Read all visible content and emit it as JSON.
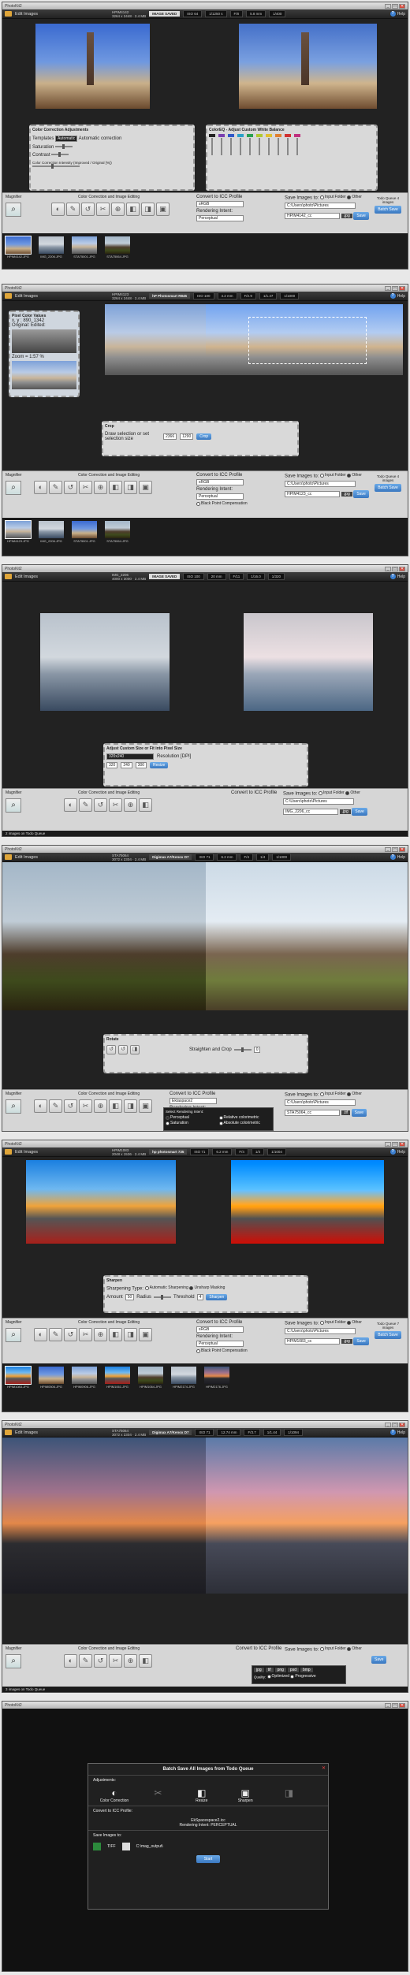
{
  "app": {
    "title": "PhotoKit2",
    "toolbar_button": "Edit Images",
    "help": "Help",
    "help_glyph": "?"
  },
  "window_controls": {
    "minimize": "_",
    "maximize": "□",
    "close": "✕"
  },
  "icons": {
    "folder": "folder-icon",
    "magnifier": "⌕",
    "tools": [
      "◐",
      "✎",
      "↺",
      "✂",
      "⊕",
      "◧",
      "◨",
      "▣"
    ]
  },
  "windows": [
    {
      "meta": [
        "HPIM4142",
        "3264 x 2448",
        "2.4 MB"
      ],
      "badge": "IMAGE SAVED",
      "stats": [
        "ISO 64",
        "1/1250 s",
        "F/8",
        "5.8 mm",
        "1/400"
      ],
      "panel_left": {
        "title": "Color Correction Adjustments",
        "templates_label": "Templates",
        "templates_value": "Automatic",
        "automatic_label": "Automatic correction",
        "saturation": "Saturation",
        "contrast": "Contrast",
        "intensity": "Color Correction Intensity (Improved / Original [%])"
      },
      "panel_right": {
        "title": "ColorEQ - Adjust Custom White Balance"
      },
      "bottom": {
        "magnifier": "Magnifier",
        "editing": "Color Correction and Image Editing",
        "icc_label": "Convert to ICC Profile",
        "icc_value": "sRGB",
        "rendering_label": "Rendering Intent:",
        "rendering_value": "Perceptual",
        "bpc": "Black Point Compensation",
        "save_to": "Save Images to:",
        "input_folder": "Input Folder",
        "other": "Other",
        "path": "C:\\Users\\photo\\Pictures",
        "file": "HPIM4142_cc",
        "format": ".jpg",
        "save": "Save",
        "todo": "Todo Queue 4 images",
        "batch": "Batch Save"
      },
      "thumbs": [
        "HPIM4142.JPG",
        "IMG_2206.JPG",
        "STA75001.JPG",
        "STA75064.JPG"
      ]
    },
    {
      "meta": [
        "HPIM4123",
        "3264 x 2448",
        "2.4 MB"
      ],
      "badge": "hP Photosmart R845",
      "stats": [
        "ISO 100",
        "4.2 mm",
        "F/2.9",
        "1/1.47",
        "1/1000"
      ],
      "picker": {
        "title": "Pixel Color Values",
        "coord": "x, y : 890, 1342",
        "original": "Original:",
        "edited": "Edited:",
        "zoom": "Zoom = 1:57 %"
      },
      "crop": {
        "title": "Crop",
        "hint": "Draw selection or set selection size",
        "w": "2366",
        "h": "1290",
        "button": "Crop"
      },
      "bottom": {
        "file": "HPIM4123_cc",
        "path": "C:\\Users\\photo\\Pictures",
        "todo": "Todo Queue 4 images"
      },
      "thumbs": [
        "HPIM4123.JPG",
        "IMG_2206.JPG",
        "STA75001.JPG",
        "STA75064.JPG"
      ]
    },
    {
      "meta": [
        "IMG_2206",
        "4000 x 3000",
        "2.4 MB"
      ],
      "badge": "IMAGE SAVED",
      "stats": [
        "ISO 100",
        "20 mm",
        "F/11",
        "1/16.0",
        "1/320"
      ],
      "resize": {
        "title": "Adjust Custom Size or Fit into Pixel Size",
        "preset": "320x240",
        "w": "320",
        "h": "240",
        "res_label": "Resolution [DPI]",
        "res": "300",
        "button": "Resize"
      },
      "bottom": {
        "file": "IMG_2206_cc",
        "path": "C:\\Users\\photo\\Pictures"
      },
      "status": "2 images on Todo Queue"
    },
    {
      "meta": [
        "STA75064",
        "3072 x 2304",
        "2.4 MB"
      ],
      "badge": "Digimax A7/Kenox D7",
      "stats": [
        "ISO 71",
        "6.2 mm",
        "F/4",
        "1/4",
        "1/1000"
      ],
      "rotate": {
        "title": "Rotate",
        "straighten": "Straighten and Crop",
        "angle": "0"
      },
      "intent": {
        "label": "Select Rendering Intent:",
        "options": [
          "Perceptual",
          "Relative colorimetric",
          "Saturation",
          "Absolute colorimetric"
        ]
      },
      "bottom": {
        "icc_value": "Ektaspace2",
        "file": "STA75064_cc",
        "path": "C:\\Users\\photo\\Pictures",
        "format": ".tif"
      }
    },
    {
      "meta": [
        "HPIM1083",
        "2048 x 1536",
        "2.4 MB"
      ],
      "badge": "hp photosmart 735",
      "stats": [
        "ISO 71",
        "6.2 mm",
        "F/4",
        "1/4",
        "1/1004"
      ],
      "sharpen": {
        "title": "Sharpen",
        "type_label": "Sharpening Type:",
        "auto": "Automatic Sharpening",
        "unsharp": "Unsharp Masking",
        "amount_label": "Amount",
        "amount": "50",
        "radius_label": "Radius",
        "threshold_label": "Threshold",
        "threshold": "4",
        "button": "Sharpen"
      },
      "bottom": {
        "file": "HPIM1083_cc",
        "path": "C:\\Users\\photo\\Pictures",
        "todo": "Todo Queue 7 images"
      },
      "thumbs": [
        "HPIM1083.JPG",
        "HPIM0506.JPG",
        "HPIM0906.JPG",
        "HPIM1061.JPG",
        "HPIM1064.JPG",
        "HPIM2174.JPG",
        "HPIM2176.JPG"
      ]
    },
    {
      "meta": [
        "STA75064",
        "3072 x 2304",
        "2.4 MB"
      ],
      "badge": "Digimax A7/Kenox D7",
      "stats": [
        "ISO 71",
        "12.74 mm",
        "F/3.7",
        "1/1.44",
        "1/1094"
      ],
      "formats": [
        "jpg",
        "tif",
        "png",
        "psd",
        "bmp"
      ],
      "quality": "Quality:",
      "opts": [
        "Optimized",
        "Progressive"
      ],
      "status": "3 images on Todo Queue"
    }
  ],
  "batch": {
    "title": "Batch Save All Images from Todo Queue",
    "adjustments": "Adjustments:",
    "items": [
      "Color Correction",
      "Resize",
      "Sharpen"
    ],
    "convert": "Convert to ICC Profile:",
    "profile": "EkSpacespace2.icc",
    "intent": "Rendering Intent: PERCEPTUAL",
    "save_to": "Save Images to:",
    "fmt": "TIFF",
    "path": "C:\\mag_output\\",
    "start": "Start"
  }
}
